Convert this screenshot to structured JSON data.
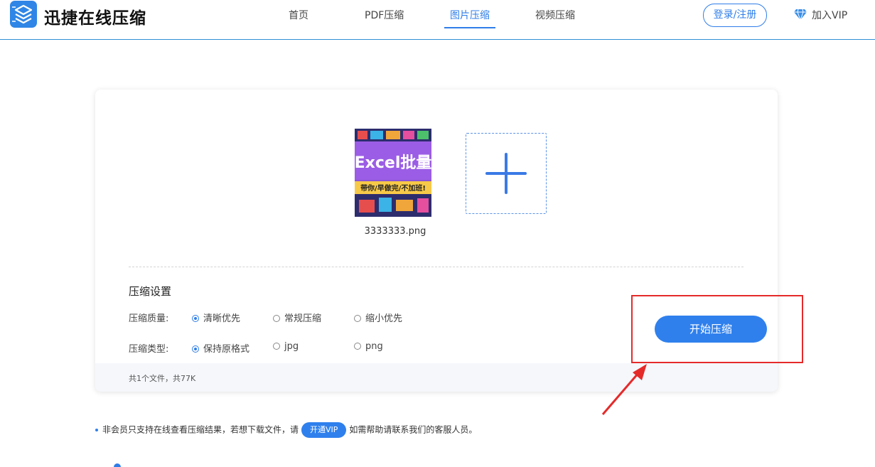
{
  "brand": {
    "name": "迅捷在线压缩",
    "logo_icon": "layers-icon",
    "color": "#2f86e6"
  },
  "nav": {
    "items": [
      {
        "label": "首页",
        "active": false
      },
      {
        "label": "PDF压缩",
        "active": false
      },
      {
        "label": "图片压缩",
        "active": true
      },
      {
        "label": "视频压缩",
        "active": false
      }
    ],
    "login": "登录/注册",
    "vip": {
      "label": "加入VIP",
      "icon": "diamond-icon"
    }
  },
  "upload": {
    "file": {
      "name": "3333333.png",
      "thumb_text": {
        "headline": "Excel批量",
        "banner": "带你/早做完/不加班!"
      }
    },
    "add_icon": "plus-icon"
  },
  "settings": {
    "title": "压缩设置",
    "quality": {
      "label": "压缩质量:",
      "options": [
        {
          "label": "清晰优先",
          "checked": true
        },
        {
          "label": "常规压缩",
          "checked": false
        },
        {
          "label": "缩小优先",
          "checked": false
        }
      ]
    },
    "type": {
      "label": "压缩类型:",
      "options": [
        {
          "label": "保持原格式",
          "checked": true
        },
        {
          "label": "jpg",
          "checked": false
        },
        {
          "label": "png",
          "checked": false
        }
      ]
    },
    "start_button": "开始压缩"
  },
  "summary": "共1个文件，共77K",
  "notice": {
    "before": "非会员只支持在线查看压缩结果，若想下载文件，请",
    "button": "开通VIP",
    "after": "如需帮助请联系我们的客服人员。"
  },
  "colors": {
    "accent": "#2f80ed",
    "highlight": "#e52a2a"
  }
}
